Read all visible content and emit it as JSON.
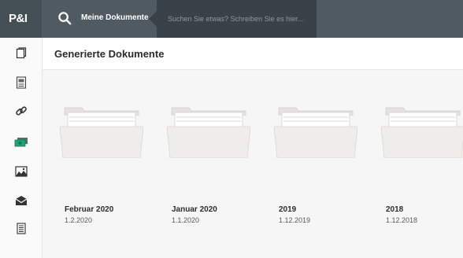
{
  "app": {
    "logo_text": "P&I",
    "breadcrumb": "Meine Dokumente",
    "search": {
      "placeholder": "Suchen Sie etwas? Schreiben Sie es hier..."
    }
  },
  "sidebar": {
    "items": [
      {
        "icon": "document-icon",
        "active": false
      },
      {
        "icon": "form-icon",
        "active": false
      },
      {
        "icon": "link-icon",
        "active": false
      },
      {
        "icon": "money-icon",
        "active": true
      },
      {
        "icon": "landscape-icon",
        "active": false
      },
      {
        "icon": "mail-icon",
        "active": false
      },
      {
        "icon": "list-icon",
        "active": false
      }
    ]
  },
  "main": {
    "title": "Generierte Dokumente",
    "folders": [
      {
        "name": "Februar 2020",
        "date": "1.2.2020"
      },
      {
        "name": "Januar 2020",
        "date": "1.1.2020"
      },
      {
        "name": "2019",
        "date": "1.12.2019"
      },
      {
        "name": "2018",
        "date": "1.12.2018"
      }
    ]
  },
  "colors": {
    "topbar": "#4f5a62",
    "search_bg": "#394248",
    "accent_green": "#1aa67a",
    "folder_fill": "#efedea"
  }
}
